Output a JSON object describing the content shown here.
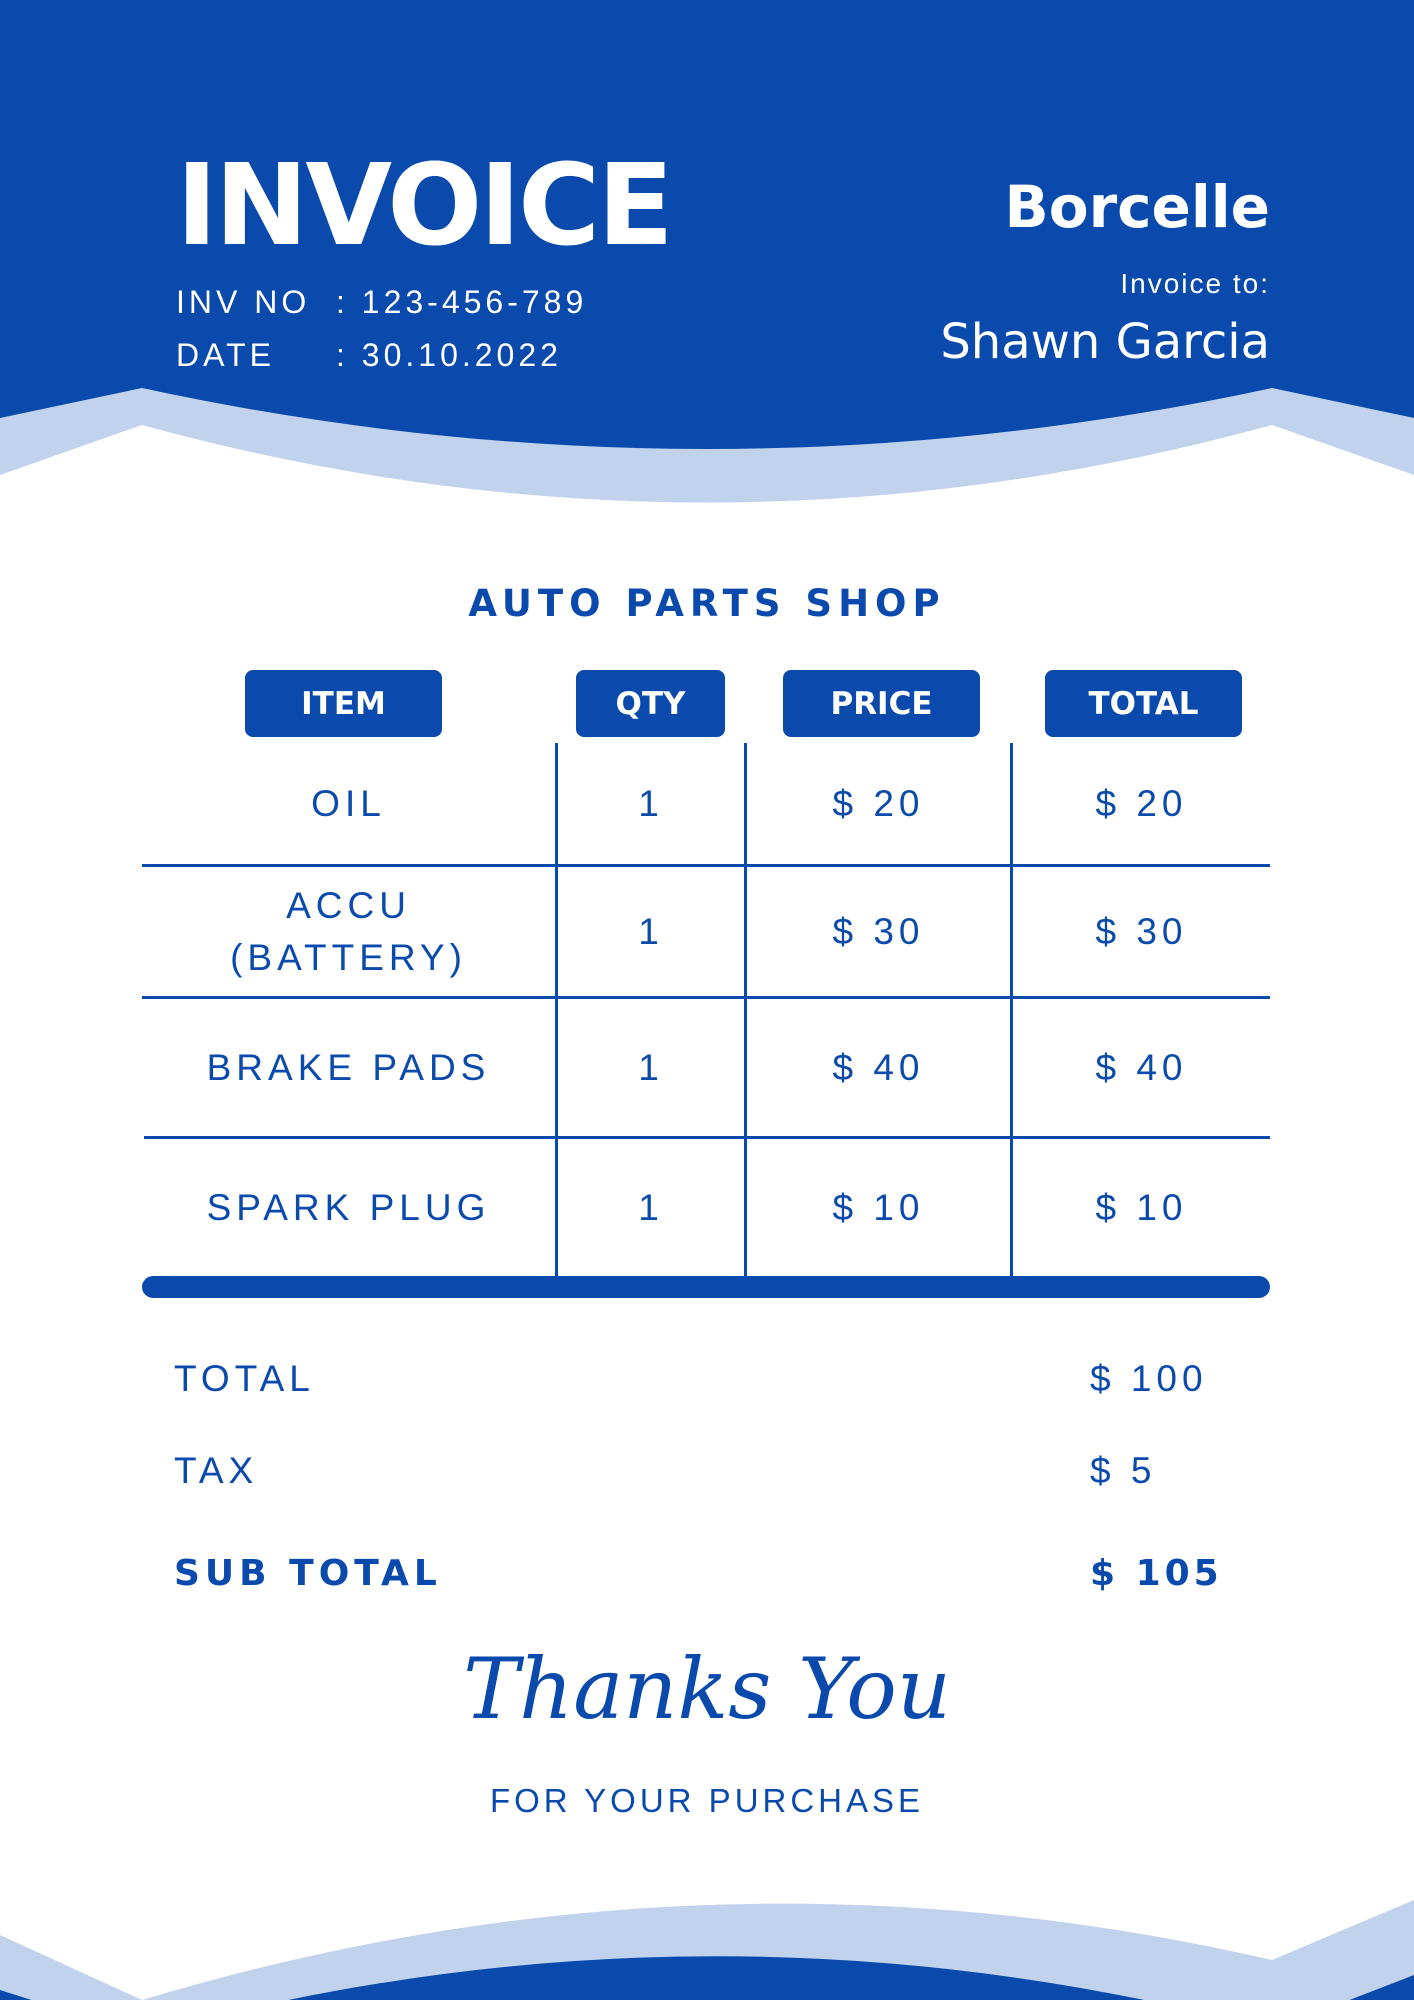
{
  "header": {
    "title": "INVOICE",
    "inv_no_label": "INV NO",
    "inv_no_value": ": 123-456-789",
    "date_label": "DATE",
    "date_value": ": 30.10.2022",
    "brand": "Borcelle",
    "invoice_to_label": "Invoice to:",
    "client_name": "Shawn Garcia"
  },
  "shop_name": "AUTO PARTS SHOP",
  "table": {
    "columns": [
      "ITEM",
      "QTY",
      "PRICE",
      "TOTAL"
    ],
    "rows": [
      {
        "item": "OIL",
        "qty": "1",
        "price": "$ 20",
        "total": "$ 20"
      },
      {
        "item": "ACCU\n(BATTERY)",
        "qty": "1",
        "price": "$ 30",
        "total": "$ 30"
      },
      {
        "item": "BRAKE PADS",
        "qty": "1",
        "price": "$ 40",
        "total": "$ 40"
      },
      {
        "item": "SPARK PLUG",
        "qty": "1",
        "price": "$ 10",
        "total": "$ 10"
      }
    ]
  },
  "summary": {
    "total_label": "TOTAL",
    "total_value": "$ 100",
    "tax_label": "TAX",
    "tax_value": "$ 5",
    "subtotal_label": "SUB TOTAL",
    "subtotal_value": "$ 105"
  },
  "footer": {
    "thanks": "Thanks You",
    "thanks_sub": "FOR YOUR PURCHASE"
  },
  "colors": {
    "primary": "#0a4aad",
    "light": "#c1d3ec",
    "background": "#ffffff"
  }
}
